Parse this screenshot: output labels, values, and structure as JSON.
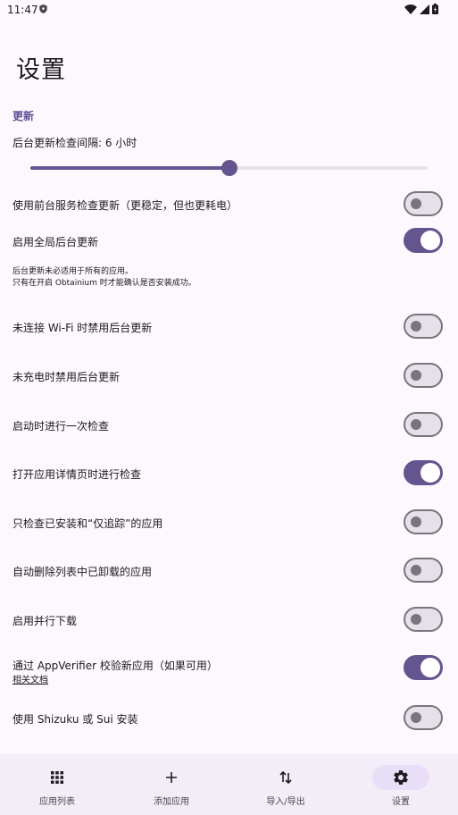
{
  "status_bar": {
    "time": "11:47"
  },
  "page": {
    "title": "设置"
  },
  "section": {
    "header": "更新"
  },
  "interval": {
    "label": "后台更新检查间隔: 6 小时",
    "slider_fraction": 0.5
  },
  "rows": [
    {
      "label": "使用前台服务检查更新（更稳定，但也更耗电）",
      "checked": false
    },
    {
      "label": "启用全局后台更新",
      "checked": true
    },
    {
      "label": "未连接 Wi-Fi 时禁用后台更新",
      "checked": false
    },
    {
      "label": "未充电时禁用后台更新",
      "checked": false
    },
    {
      "label": "启动时进行一次检查",
      "checked": false
    },
    {
      "label": "打开应用详情页时进行检查",
      "checked": true
    },
    {
      "label": "只检查已安装和“仅追踪”的应用",
      "checked": false
    },
    {
      "label": "自动删除列表中已卸载的应用",
      "checked": false
    },
    {
      "label": "启用并行下载",
      "checked": false
    },
    {
      "label": "通过 AppVerifier 校验新应用（如果可用）",
      "checked": true,
      "link": "相关文档"
    },
    {
      "label": "使用 Shizuku 或 Sui 安装",
      "checked": false
    }
  ],
  "note": {
    "line1": "后台更新未必适用于所有的应用。",
    "line2": "只有在开启 Obtainium 时才能确认是否安装成功。"
  },
  "nav": [
    {
      "label": "应用列表",
      "icon": "apps-grid-icon",
      "active": false
    },
    {
      "label": "添加应用",
      "icon": "add-icon",
      "active": false
    },
    {
      "label": "导入/导出",
      "icon": "import-export-icon",
      "active": false
    },
    {
      "label": "设置",
      "icon": "gear-icon",
      "active": true
    }
  ],
  "colors": {
    "accent": "#65558f",
    "background": "#fdf7fe",
    "nav_background": "#f3edf7"
  }
}
